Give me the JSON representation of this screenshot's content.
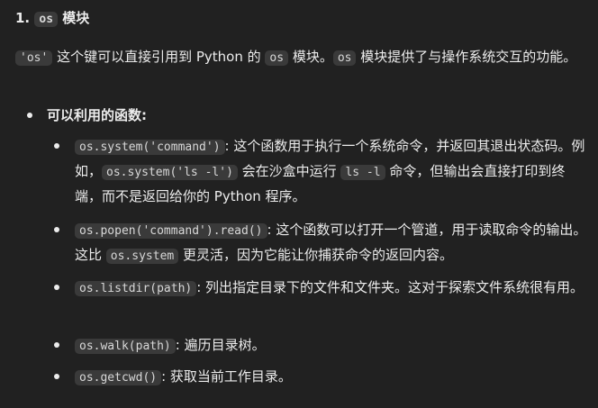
{
  "section": {
    "number": "1.",
    "code": "os",
    "title": "模块"
  },
  "intro": {
    "code1": "'os'",
    "t1": " 这个键可以直接引用到 Python 的 ",
    "code2": "os",
    "t2": " 模块。",
    "code3": "os",
    "t3": " 模块提供了与操作系统交互的功能。"
  },
  "functions_heading": "可以利用的函数:",
  "items": [
    {
      "code": "os.system('command')",
      "text_a": ": 这个函数用于执行一个系统命令，并返回其退出状态码。例如，",
      "code_b": "os.system('ls -l')",
      "text_b": " 会在沙盒中运行 ",
      "code_c": "ls -l",
      "text_c": " 命令，但输出会直接打印到终端，而不是返回给你的 Python 程序。"
    },
    {
      "code": "os.popen('command').read()",
      "text_a": ": 这个函数可以打开一个管道，用于读取命令的输出。这比 ",
      "code_b": "os.system",
      "text_b": " 更灵活，因为它能让你捕获命令的返回内容。"
    },
    {
      "code": "os.listdir(path)",
      "text_a": ": 列出指定目录下的文件和文件夹。这对于探索文件系统很有用。"
    },
    {
      "code": "os.walk(path)",
      "text_a": ": 遍历目录树。"
    },
    {
      "code": "os.getcwd()",
      "text_a": ": 获取当前工作目录。"
    }
  ]
}
